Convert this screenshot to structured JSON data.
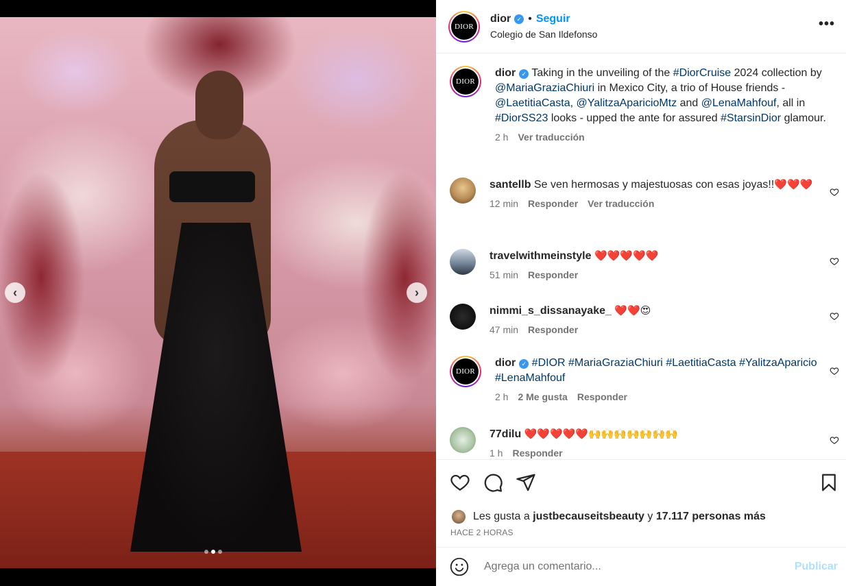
{
  "post": {
    "username": "dior",
    "follow_label": "Seguir",
    "separator": "•",
    "location": "Colegio de San Ildefonso",
    "more_label": "•••",
    "avatar_text": "DIOR",
    "caption": {
      "username": "dior",
      "segments": [
        {
          "t": "Taking in the unveiling of the ",
          "tag": false
        },
        {
          "t": "#DiorCruise",
          "tag": true
        },
        {
          "t": " 2024 collection by ",
          "tag": false
        },
        {
          "t": "@MariaGraziaChiuri",
          "tag": true
        },
        {
          "t": " in Mexico City, a trio of House friends - ",
          "tag": false
        },
        {
          "t": "@LaetitiaCasta",
          "tag": true
        },
        {
          "t": ", ",
          "tag": false
        },
        {
          "t": "@YalitzaAparicioMtz",
          "tag": true
        },
        {
          "t": " and ",
          "tag": false
        },
        {
          "t": "@LenaMahfouf",
          "tag": true
        },
        {
          "t": ", all in ",
          "tag": false
        },
        {
          "t": "#DiorSS23",
          "tag": true
        },
        {
          "t": " looks - upped the ante for assured ",
          "tag": false
        },
        {
          "t": "#StarsinDior",
          "tag": true
        },
        {
          "t": " glamour.",
          "tag": false
        }
      ],
      "time": "2 h",
      "translate": "Ver traducción"
    }
  },
  "comments": [
    {
      "username": "santellb",
      "text": "Se ven hermosas y majestuosas con esas joyas!!",
      "emojis": "❤️❤️❤️",
      "time": "12 min",
      "reply": "Responder",
      "translate": "Ver traducción"
    },
    {
      "username": "travelwithmeinstyle",
      "text": "",
      "emojis": "❤️❤️❤️❤️❤️",
      "time": "51 min",
      "reply": "Responder"
    },
    {
      "username": "nimmi_s_dissanayake_",
      "text": "",
      "emojis": "❤️❤️😍",
      "time": "47 min",
      "reply": "Responder"
    },
    {
      "username": "dior",
      "tags": [
        "#DIOR",
        "#MariaGraziaChiuri",
        "#LaetitiaCasta",
        "#YalitzaAparicio",
        "#LenaMahfouf"
      ],
      "time": "2 h",
      "likes": "2 Me gusta",
      "reply": "Responder"
    },
    {
      "username": "77dilu",
      "text": "",
      "emojis": "❤️❤️❤️❤️❤️🙌🙌🙌🙌🙌🙌🙌",
      "time": "1 h",
      "reply": "Responder"
    }
  ],
  "likes": {
    "prefix": "Les gusta a",
    "user": "justbecauseitsbeauty",
    "and": "y",
    "count": "17.117 personas más"
  },
  "time_ago": "HACE 2 HORAS",
  "comment_input": {
    "placeholder": "Agrega un comentario...",
    "publish": "Publicar"
  },
  "media": {
    "slides": 3,
    "active_slide": 2
  },
  "colors": {
    "link": "#00376b",
    "follow": "#0095f6",
    "verified": "#3897f0",
    "publish_disabled": "#b2dffc"
  },
  "icons": [
    "heart-icon",
    "comment-icon",
    "share-icon",
    "bookmark-icon",
    "emoji-icon",
    "verified-icon",
    "chevron-left-icon",
    "chevron-right-icon"
  ]
}
